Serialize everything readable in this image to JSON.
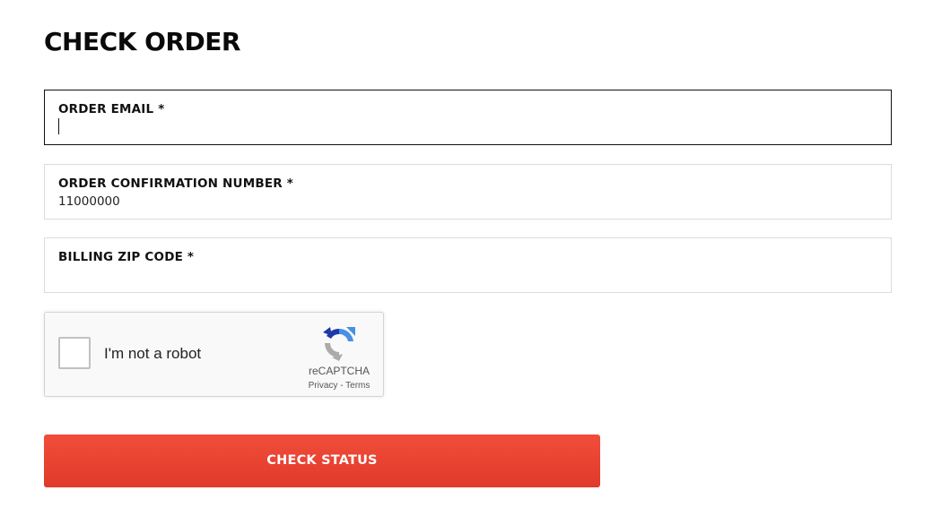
{
  "page": {
    "title": "CHECK ORDER"
  },
  "form": {
    "email": {
      "label": "ORDER EMAIL *",
      "value": "",
      "placeholder": ""
    },
    "confirmation": {
      "label": "ORDER CONFIRMATION NUMBER *",
      "value": "11000000",
      "placeholder": ""
    },
    "zip": {
      "label": "BILLING ZIP CODE *",
      "value": "",
      "placeholder": ""
    },
    "submit_label": "CHECK STATUS"
  },
  "recaptcha": {
    "prompt": "I'm not a robot",
    "brand": "reCAPTCHA",
    "privacy_label": "Privacy",
    "separator": " - ",
    "terms_label": "Terms",
    "logo_icon": "recaptcha-logo-icon"
  },
  "colors": {
    "button_top": "#f24c3a",
    "button_bottom": "#e03a2b",
    "recaptcha_blue": "#4a90e2",
    "recaptcha_gray": "#ababab",
    "recaptcha_dark_blue": "#1c3aa9"
  }
}
